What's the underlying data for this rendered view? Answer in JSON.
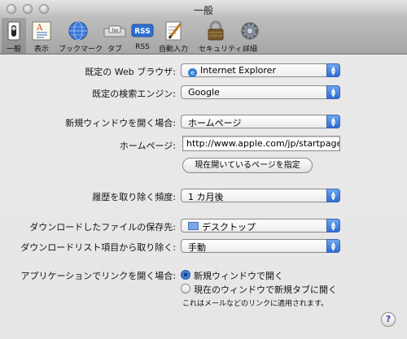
{
  "window": {
    "title": "一般"
  },
  "toolbar": {
    "items": [
      {
        "label": "一般",
        "icon": "switch-icon"
      },
      {
        "label": "表示",
        "icon": "appearance-icon"
      },
      {
        "label": "ブックマーク",
        "icon": "globe-icon"
      },
      {
        "label": "タブ",
        "icon": "tabs-icon"
      },
      {
        "label": "RSS",
        "icon": "rss-icon"
      },
      {
        "label": "自動入力",
        "icon": "pencil-paper-icon"
      },
      {
        "label": "セキュリティ",
        "icon": "lock-icon"
      },
      {
        "label": "詳細",
        "icon": "gear-icon"
      }
    ],
    "rss_badge": "RSS",
    "tab_badge": "Tab",
    "appearance_badge": "A"
  },
  "general": {
    "default_browser": {
      "label": "既定の Web ブラウザ:",
      "value": "Internet Explorer"
    },
    "default_search": {
      "label": "既定の検索エンジン:",
      "value": "Google"
    },
    "new_window": {
      "label": "新規ウィンドウを開く場合:",
      "value": "ホームページ"
    },
    "homepage": {
      "label": "ホームページ:",
      "value": "http://www.apple.com/jp/startpage"
    },
    "set_current_button": "現在開いているページを指定",
    "history": {
      "label": "履歴を取り除く頻度:",
      "value": "1 カ月後"
    },
    "download_location": {
      "label": "ダウンロードしたファイルの保存先:",
      "value": "デスクトップ"
    },
    "download_list": {
      "label": "ダウンロードリスト項目から取り除く:",
      "value": "手動"
    },
    "links": {
      "label": "アプリケーションでリンクを開く場合:",
      "options": [
        "新規ウィンドウで開く",
        "現在のウィンドウで新規タブに開く"
      ],
      "selected": 0,
      "note": "これはメールなどのリンクに適用されます。"
    },
    "help": "?"
  }
}
